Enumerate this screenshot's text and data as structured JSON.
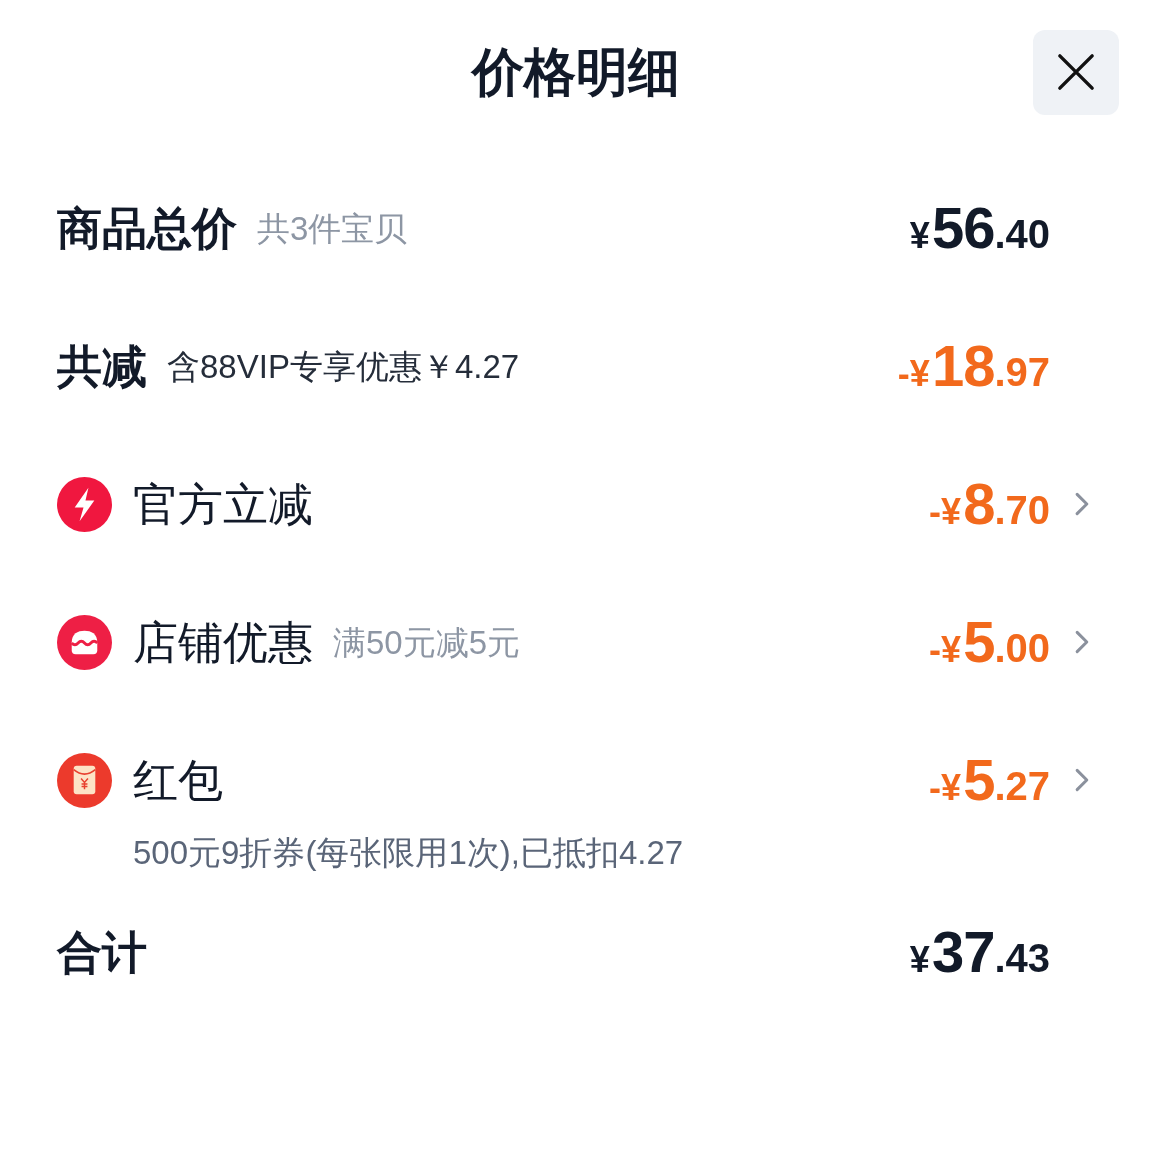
{
  "title": "价格明细",
  "rows": [
    {
      "kind": "heading",
      "label": "商品总价",
      "note": {
        "text": "共3件宝贝",
        "muted": true
      },
      "amount": {
        "prefix": "¥",
        "integer": "56",
        "fraction": ".40"
      },
      "discount": false,
      "chevron": false
    },
    {
      "kind": "heading",
      "label": "共减",
      "note": {
        "text": "含88VIP专享优惠￥4.27",
        "muted": false
      },
      "amount": {
        "prefix": "-¥",
        "integer": "18",
        "fraction": ".97"
      },
      "discount": true,
      "chevron": false
    },
    {
      "kind": "item",
      "label": "官方立减",
      "amount": {
        "prefix": "-¥",
        "integer": "8",
        "fraction": ".70"
      },
      "discount": true,
      "chevron": true
    },
    {
      "kind": "item",
      "label": "店铺优惠",
      "note": {
        "text": "满50元减5元",
        "muted": true
      },
      "amount": {
        "prefix": "-¥",
        "integer": "5",
        "fraction": ".00"
      },
      "discount": true,
      "chevron": true
    },
    {
      "kind": "item",
      "label": "红包",
      "amount": {
        "prefix": "-¥",
        "integer": "5",
        "fraction": ".27"
      },
      "discount": true,
      "chevron": true,
      "detail": "500元9折券(每张限用1次),已抵扣4.27"
    },
    {
      "kind": "heading",
      "label": "合计",
      "amount": {
        "prefix": "¥",
        "integer": "37",
        "fraction": ".43"
      },
      "discount": false,
      "chevron": false
    }
  ]
}
